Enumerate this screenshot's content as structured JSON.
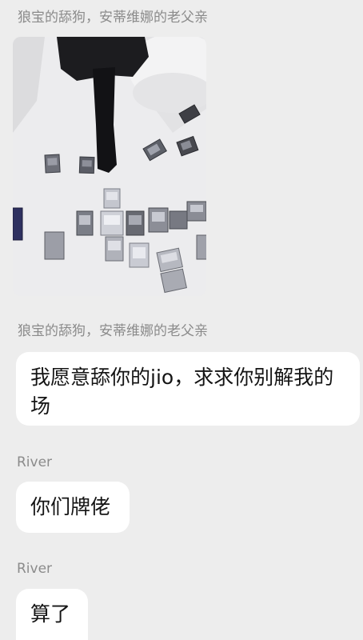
{
  "messages": [
    {
      "sender": "狼宝的舔狗，安蒂维娜的老父亲",
      "type": "image",
      "image_alt": "photo of trading cards on a bed"
    },
    {
      "sender": "狼宝的舔狗，安蒂维娜的老父亲",
      "type": "text",
      "text": "我愿意舔你的jio，求求你别解我的场"
    },
    {
      "sender": "River",
      "type": "text",
      "text": "你们牌佬"
    },
    {
      "sender": "River",
      "type": "text",
      "text": "算了"
    }
  ],
  "colors": {
    "background": "#ededed",
    "bubble": "#ffffff",
    "sender_name": "#8b8b8b",
    "message_text": "#141414"
  }
}
